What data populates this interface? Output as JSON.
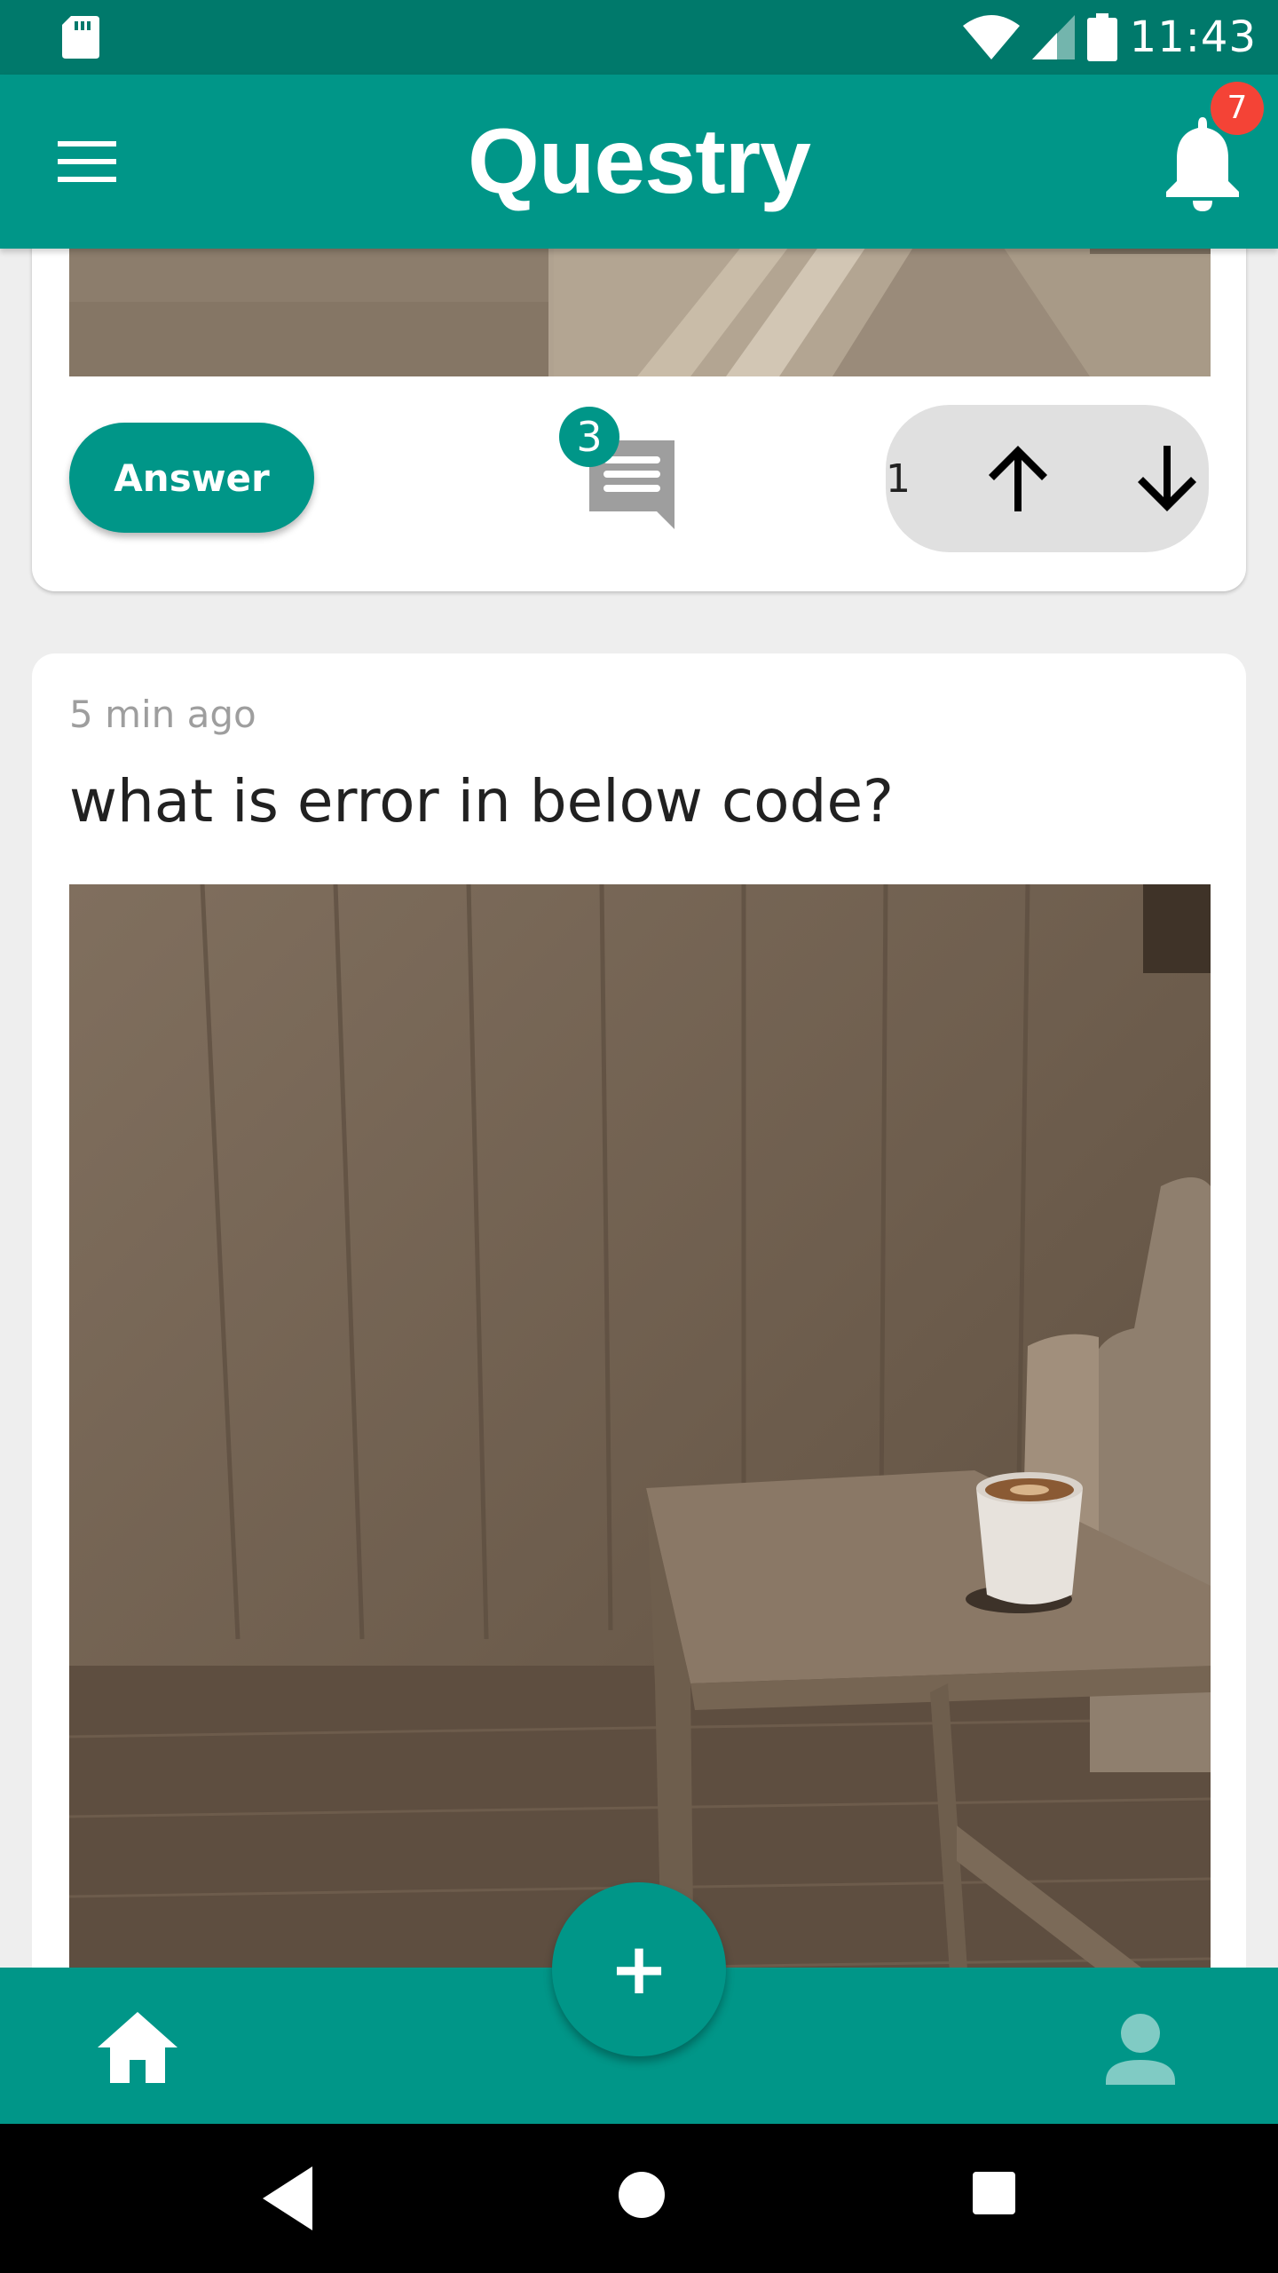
{
  "status_bar": {
    "time": "11:43",
    "icons": [
      "sd-card-icon",
      "wifi-icon",
      "signal-icon",
      "battery-icon"
    ]
  },
  "toolbar": {
    "title": "Questry",
    "menu_icon": "hamburger-menu-icon",
    "notification_icon": "bell-icon",
    "notification_count": "7"
  },
  "feed": {
    "card_prev": {
      "answer_label": "Answer",
      "comment_count": "3",
      "vote_count": "1",
      "upvote_icon": "arrow-up-icon",
      "downvote_icon": "arrow-down-icon"
    },
    "card_current": {
      "timestamp": "5 min ago",
      "question": "what is error in below code?"
    }
  },
  "fab": {
    "label": "+"
  },
  "bottom_nav": {
    "items": [
      "home-icon",
      "profile-icon"
    ]
  },
  "colors": {
    "primary": "#009688",
    "primary_dark": "#00796b",
    "badge": "#f44336",
    "vote_bg": "#e0e0e0",
    "background": "#eeeeee"
  }
}
